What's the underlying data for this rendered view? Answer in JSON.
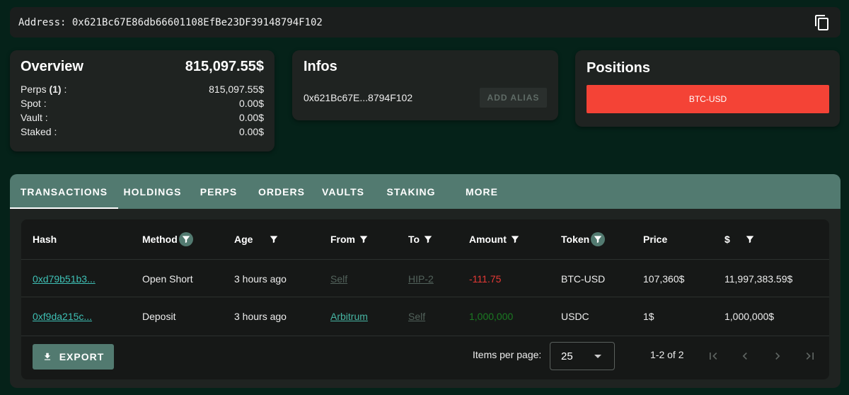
{
  "address_bar": {
    "label": "Address: 0x621Bc67E86db66601108EfBe23DF39148794F102"
  },
  "overview": {
    "title": "Overview",
    "total": "815,097.55$",
    "rows": [
      {
        "label": "Perps ",
        "count": "(1)",
        "suffix": " :",
        "value": "815,097.55$"
      },
      {
        "label": "Spot :",
        "value": "0.00$"
      },
      {
        "label": "Vault :",
        "value": "0.00$"
      },
      {
        "label": "Staked :",
        "value": "0.00$"
      }
    ]
  },
  "infos": {
    "title": "Infos",
    "short_address": "0x621Bc67E...8794F102",
    "add_alias_label": "ADD ALIAS"
  },
  "positions": {
    "title": "Positions",
    "items": [
      "BTC-USD"
    ]
  },
  "tabs": [
    "TRANSACTIONS",
    "HOLDINGS",
    "PERPS",
    "ORDERS",
    "VAULTS",
    "STAKING",
    "MORE"
  ],
  "table": {
    "headers": [
      "Hash",
      "Method",
      "Age",
      "From",
      "To",
      "Amount",
      "Token",
      "Price",
      "$"
    ],
    "rows": [
      {
        "hash": "0xd79b51b3...",
        "method": "Open Short",
        "age": "3 hours ago",
        "from": "Self",
        "to": "HIP-2",
        "amount": "-111.75",
        "token": "BTC-USD",
        "price": "107,360$",
        "usd": "11,997,383.59$"
      },
      {
        "hash": "0xf9da215c...",
        "method": "Deposit",
        "age": "3 hours ago",
        "from": "Arbitrum",
        "to": "Self",
        "amount": "1,000,000",
        "token": "USDC",
        "price": "1$",
        "usd": "1,000,000$"
      }
    ]
  },
  "footer": {
    "export_label": "EXPORT",
    "items_per_page_label": "Items per page:",
    "items_per_page": "25",
    "range": "1-2 of 2"
  },
  "colors": {
    "accent": "#527a70",
    "negative": "#e53935",
    "positive": "#1b7a22",
    "position_button": "#f44336",
    "link": "#3ec0b5"
  }
}
